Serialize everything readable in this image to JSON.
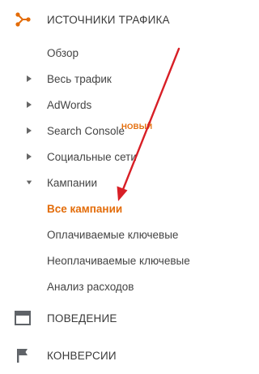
{
  "sections": {
    "traffic": {
      "label": "ИСТОЧНИКИ ТРАФИКА",
      "icon": "traffic-sources-icon",
      "color": "#e36c09"
    },
    "behavior": {
      "label": "ПОВЕДЕНИЕ",
      "icon": "behavior-icon"
    },
    "conversions": {
      "label": "КОНВЕРСИИ",
      "icon": "flag-icon"
    }
  },
  "nav": {
    "overview": "Обзор",
    "all_traffic": "Весь трафик",
    "adwords": "AdWords",
    "search_console": "Search Console",
    "search_console_badge": "НОВЫЙ",
    "social": "Социальные сети",
    "campaigns": "Кампании",
    "all_campaigns": "Все кампании",
    "paid_keywords": "Оплачиваемые ключевые",
    "organic_keywords": "Неоплачиваемые ключевые",
    "cost_analysis": "Анализ расходов"
  },
  "colors": {
    "accent": "#e36c09",
    "arrow": "#d81f26",
    "icon_gray": "#5f6368"
  }
}
